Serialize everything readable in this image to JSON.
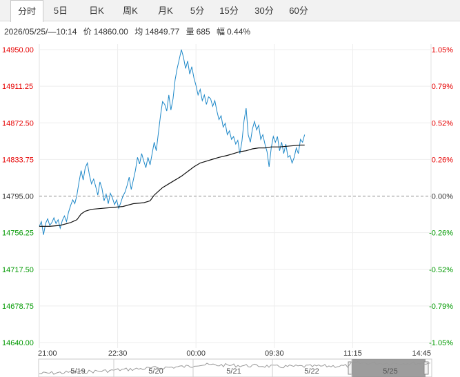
{
  "tabs": [
    {
      "label": "分时",
      "active": true
    },
    {
      "label": "5日"
    },
    {
      "label": "日K"
    },
    {
      "label": "周K"
    },
    {
      "label": "月K"
    },
    {
      "label": "5分"
    },
    {
      "label": "15分"
    },
    {
      "label": "30分"
    },
    {
      "label": "60分"
    }
  ],
  "info": {
    "datetime": "2026/05/25/—10:14",
    "price_label": "价",
    "price": "14860.00",
    "avg_label": "均",
    "avg": "14849.77",
    "vol_label": "量",
    "vol": "685",
    "amp_label": "幅",
    "amp": "0.44%"
  },
  "colors": {
    "up": "#e60000",
    "down": "#009900",
    "price_line": "#1e88c8",
    "avg_line": "#111111"
  },
  "chart_data": {
    "type": "line",
    "ylim": [
      14640.0,
      14950.0
    ],
    "base": 14795.0,
    "y_ticks": [
      "14950.00",
      "14911.25",
      "14872.50",
      "14833.75",
      "14795.00",
      "14756.25",
      "14717.50",
      "14678.75",
      "14640.00"
    ],
    "y_ticks_right": [
      "1.05%",
      "0.79%",
      "0.52%",
      "0.26%",
      "0.00%",
      "-0.26%",
      "-0.52%",
      "-0.79%",
      "-1.05%"
    ],
    "x_ticks": [
      "21:00",
      "22:30",
      "00:00",
      "09:30",
      "11:15",
      "14:45"
    ],
    "navigator_dates": [
      "5/19",
      "5/20",
      "5/21",
      "5/22",
      "5/25"
    ],
    "price_points": [
      [
        0,
        14763
      ],
      [
        2,
        14768
      ],
      [
        4,
        14754
      ],
      [
        6,
        14766
      ],
      [
        8,
        14771
      ],
      [
        10,
        14764
      ],
      [
        12,
        14767
      ],
      [
        14,
        14772
      ],
      [
        16,
        14766
      ],
      [
        18,
        14770
      ],
      [
        20,
        14761
      ],
      [
        22,
        14769
      ],
      [
        24,
        14774
      ],
      [
        26,
        14768
      ],
      [
        28,
        14778
      ],
      [
        30,
        14785
      ],
      [
        32,
        14791
      ],
      [
        34,
        14787
      ],
      [
        36,
        14796
      ],
      [
        38,
        14810
      ],
      [
        40,
        14822
      ],
      [
        42,
        14812
      ],
      [
        44,
        14825
      ],
      [
        46,
        14830
      ],
      [
        48,
        14817
      ],
      [
        50,
        14808
      ],
      [
        52,
        14813
      ],
      [
        54,
        14805
      ],
      [
        56,
        14796
      ],
      [
        58,
        14810
      ],
      [
        60,
        14803
      ],
      [
        62,
        14790
      ],
      [
        64,
        14797
      ],
      [
        66,
        14787
      ],
      [
        68,
        14798
      ],
      [
        70,
        14793
      ],
      [
        72,
        14786
      ],
      [
        74,
        14791
      ],
      [
        76,
        14782
      ],
      [
        78,
        14788
      ],
      [
        80,
        14795
      ],
      [
        82,
        14799
      ],
      [
        84,
        14806
      ],
      [
        86,
        14815
      ],
      [
        88,
        14802
      ],
      [
        90,
        14812
      ],
      [
        92,
        14822
      ],
      [
        94,
        14836
      ],
      [
        96,
        14829
      ],
      [
        98,
        14840
      ],
      [
        100,
        14832
      ],
      [
        102,
        14825
      ],
      [
        104,
        14836
      ],
      [
        106,
        14828
      ],
      [
        108,
        14840
      ],
      [
        110,
        14852
      ],
      [
        112,
        14843
      ],
      [
        114,
        14862
      ],
      [
        116,
        14880
      ],
      [
        118,
        14895
      ],
      [
        120,
        14892
      ],
      [
        122,
        14885
      ],
      [
        124,
        14902
      ],
      [
        126,
        14886
      ],
      [
        128,
        14898
      ],
      [
        130,
        14918
      ],
      [
        132,
        14930
      ],
      [
        134,
        14940
      ],
      [
        136,
        14950
      ],
      [
        138,
        14942
      ],
      [
        140,
        14930
      ],
      [
        142,
        14938
      ],
      [
        144,
        14924
      ],
      [
        146,
        14932
      ],
      [
        148,
        14920
      ],
      [
        150,
        14912
      ],
      [
        152,
        14902
      ],
      [
        154,
        14908
      ],
      [
        156,
        14896
      ],
      [
        158,
        14902
      ],
      [
        160,
        14892
      ],
      [
        162,
        14900
      ],
      [
        164,
        14898
      ],
      [
        166,
        14890
      ],
      [
        168,
        14896
      ],
      [
        170,
        14885
      ],
      [
        172,
        14876
      ],
      [
        174,
        14880
      ],
      [
        176,
        14868
      ],
      [
        178,
        14872
      ],
      [
        180,
        14860
      ],
      [
        182,
        14864
      ],
      [
        184,
        14855
      ],
      [
        186,
        14858
      ],
      [
        188,
        14850
      ],
      [
        190,
        14854
      ],
      [
        192,
        14840
      ],
      [
        194,
        14853
      ],
      [
        196,
        14875
      ],
      [
        198,
        14888
      ],
      [
        200,
        14860
      ],
      [
        202,
        14852
      ],
      [
        204,
        14866
      ],
      [
        206,
        14874
      ],
      [
        208,
        14865
      ],
      [
        210,
        14870
      ],
      [
        212,
        14855
      ],
      [
        214,
        14860
      ],
      [
        216,
        14850
      ],
      [
        218,
        14842
      ],
      [
        220,
        14826
      ],
      [
        222,
        14846
      ],
      [
        224,
        14858
      ],
      [
        226,
        14852
      ],
      [
        228,
        14858
      ],
      [
        230,
        14843
      ],
      [
        232,
        14852
      ],
      [
        234,
        14840
      ],
      [
        236,
        14850
      ],
      [
        238,
        14836
      ],
      [
        240,
        14838
      ],
      [
        242,
        14830
      ],
      [
        244,
        14836
      ],
      [
        246,
        14846
      ],
      [
        248,
        14840
      ],
      [
        250,
        14855
      ],
      [
        252,
        14852
      ],
      [
        254,
        14860
      ]
    ],
    "avg_points": [
      [
        0,
        14763
      ],
      [
        10,
        14763
      ],
      [
        20,
        14764
      ],
      [
        30,
        14767
      ],
      [
        36,
        14770
      ],
      [
        40,
        14776
      ],
      [
        44,
        14779
      ],
      [
        50,
        14781
      ],
      [
        60,
        14782
      ],
      [
        70,
        14783
      ],
      [
        80,
        14784
      ],
      [
        90,
        14787
      ],
      [
        100,
        14788
      ],
      [
        106,
        14790
      ],
      [
        110,
        14796
      ],
      [
        114,
        14800
      ],
      [
        118,
        14804
      ],
      [
        124,
        14808
      ],
      [
        130,
        14812
      ],
      [
        136,
        14816
      ],
      [
        142,
        14821
      ],
      [
        148,
        14826
      ],
      [
        154,
        14830
      ],
      [
        160,
        14832
      ],
      [
        166,
        14834
      ],
      [
        172,
        14836
      ],
      [
        180,
        14838
      ],
      [
        186,
        14840
      ],
      [
        192,
        14842
      ],
      [
        198,
        14843
      ],
      [
        204,
        14845
      ],
      [
        210,
        14846
      ],
      [
        216,
        14846
      ],
      [
        222,
        14847
      ],
      [
        230,
        14847
      ],
      [
        240,
        14848
      ],
      [
        250,
        14849
      ],
      [
        254,
        14849
      ]
    ],
    "x_max": 375
  }
}
